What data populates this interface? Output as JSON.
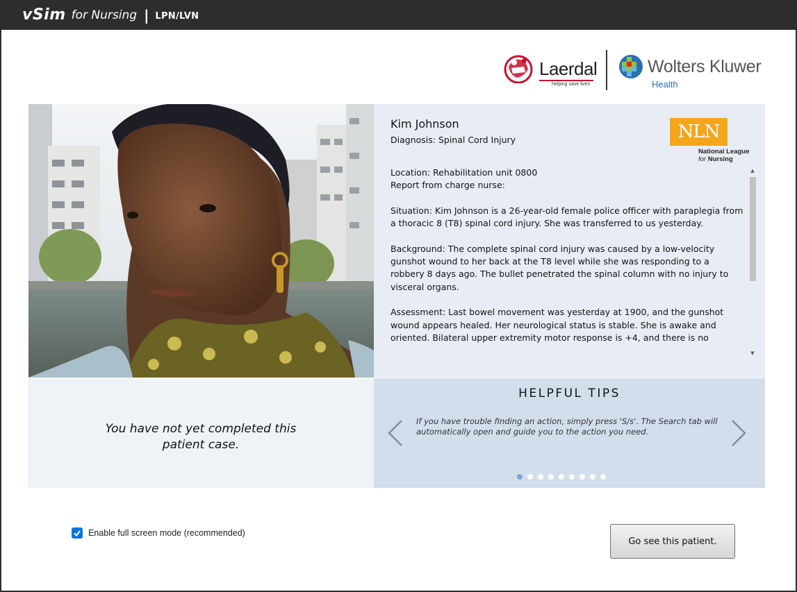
{
  "app": {
    "brand": "vSim",
    "brand_sub": "for Nursing",
    "separator": "|",
    "edition": "LPN/LVN"
  },
  "logos": {
    "laerdal_name": "Laerdal",
    "laerdal_tagline": "helping save lives",
    "wk_name": "Wolters Kluwer",
    "wk_sub": "Health",
    "nln_abbrev": "NLN",
    "nln_line1": "National League",
    "nln_line2_for": "for",
    "nln_line2_word": "Nursing"
  },
  "patient": {
    "name": "Kim Johnson",
    "diagnosis": "Diagnosis: Spinal Cord Injury",
    "location": "Location: Rehabilitation unit 0800",
    "report_heading": "Report from charge nurse:",
    "situation": "Situation: Kim Johnson is a 26-year-old female police officer with paraplegia from a thoracic 8 (T8) spinal cord injury. She was transferred to us yesterday.",
    "background": "Background: The complete spinal cord injury was caused by a low-velocity gunshot wound to her back at the T8 level while she was responding to a robbery 8 days ago. The bullet penetrated the spinal column with no injury to visceral organs.",
    "assessment": "Assessment: Last bowel movement was yesterday at 1900, and the gunshot wound appears healed. Her neurological status is stable. She is awake and oriented. Bilateral upper extremity motor response is +4, and there is no"
  },
  "status": {
    "message": "You have not yet completed this patient case."
  },
  "tips": {
    "title": "HELPFUL TIPS",
    "text": "If you have trouble finding an action, simply press 'S/s'. The Search tab will automatically open and guide you to the action you need.",
    "dot_count": 9,
    "active_index": 0
  },
  "footer": {
    "fullscreen_label": "Enable full screen mode (recommended)",
    "fullscreen_checked": true,
    "go_button": "Go see this patient."
  },
  "colors": {
    "titlebar": "#2d2d2d",
    "info_bg": "#e8edf5",
    "tips_bg": "#d3deed",
    "nln_orange": "#f4a61a",
    "checkbox_blue": "#0a75d8",
    "laerdal_red": "#c8102e",
    "wk_blue": "#2a6fb0"
  }
}
